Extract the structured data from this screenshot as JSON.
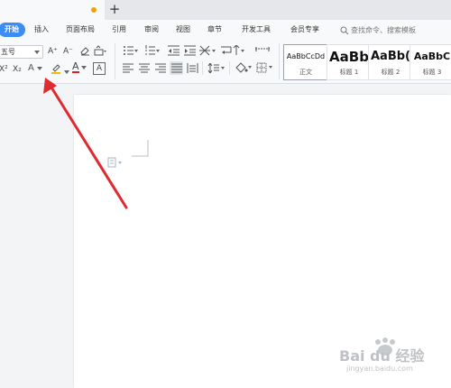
{
  "colors": {
    "accent": "#3c8cf5",
    "unsaved_dot": "#f0a300",
    "arrow": "#e12a2f",
    "font_color_underline": "#e02020",
    "highlight_underline": "#f0c000"
  },
  "tabbar": {
    "new_tab_label": "+"
  },
  "menu": {
    "items": [
      "开始",
      "插入",
      "页面布局",
      "引用",
      "审阅",
      "视图",
      "章节",
      "开发工具",
      "会员专享"
    ],
    "search_placeholder": "查找命令、搜索模板"
  },
  "ribbon": {
    "font_size_value": "五号",
    "grow_font": "A⁺",
    "shrink_font": "A⁻",
    "superscript": "X²",
    "subscript": "X₂",
    "text_effect": "A",
    "font_color": "A",
    "char_border": "A",
    "icons": {
      "clear_format": "eraser-icon",
      "pinyin": "pinyin-guide-icon",
      "bullets": "bullet-list-icon",
      "numbering": "numbered-list-icon",
      "decrease_indent": "decrease-indent-icon",
      "increase_indent": "increase-indent-icon",
      "sort": "sort-icon",
      "line_spacing": "line-spacing-icon",
      "shading": "paint-bucket-icon",
      "borders": "border-icon",
      "show_marks": "paragraph-mark-icon"
    },
    "styles": [
      {
        "sample": "AaBbCcDd",
        "name": "正文"
      },
      {
        "sample": "AaBb",
        "name": "标题 1"
      },
      {
        "sample": "AaBb(",
        "name": "标题 2"
      },
      {
        "sample": "AaBbC",
        "name": "标题 3"
      }
    ]
  },
  "watermark": {
    "brand": "Bai du 经验",
    "url": "jingyan.baidu.com"
  }
}
